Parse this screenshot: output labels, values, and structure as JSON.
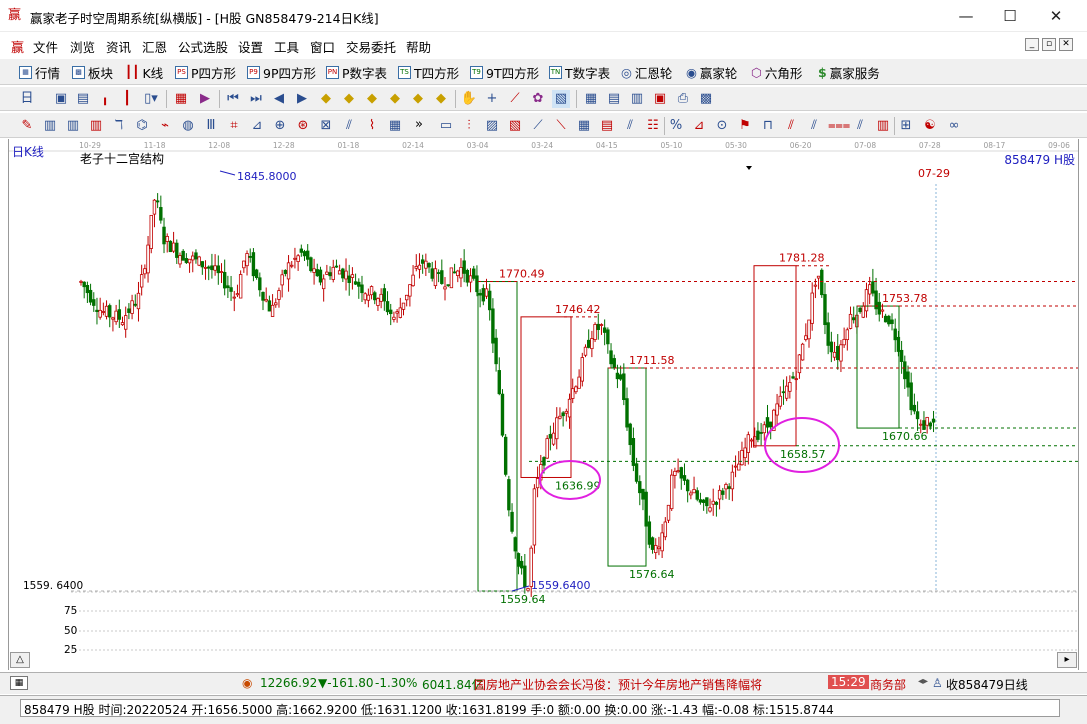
{
  "window": {
    "title": "赢家老子时空周期系统[纵横版] - [H股  GN858479-214日K线]",
    "controls": [
      "—",
      "☐",
      "✕"
    ]
  },
  "menu": {
    "items": [
      "文件",
      "浏览",
      "资讯",
      "汇恩",
      "公式选股",
      "设置",
      "工具",
      "窗口",
      "交易委托",
      "帮助"
    ],
    "mdi_buttons": [
      "_",
      "▫",
      "✕"
    ]
  },
  "toolbar1": [
    {
      "label": "行情",
      "icon": "quote-grid-icon"
    },
    {
      "label": "板块",
      "icon": "sector-icon"
    },
    {
      "label": "K线",
      "icon": "kline-icon"
    },
    {
      "label": "P四方形",
      "icon": "ps-icon",
      "badge": "PS"
    },
    {
      "label": "9P四方形",
      "icon": "p9-icon",
      "badge": "P9"
    },
    {
      "label": "P数字表",
      "icon": "pn-icon",
      "badge": "PN"
    },
    {
      "label": "T四方形",
      "icon": "ts-icon",
      "badge": "TS"
    },
    {
      "label": "9T四方形",
      "icon": "t9-icon",
      "badge": "T9"
    },
    {
      "label": "T数字表",
      "icon": "tn-icon",
      "badge": "TN"
    },
    {
      "label": "汇恩轮",
      "icon": "wheel-icon"
    },
    {
      "label": "赢家轮",
      "icon": "winner-wheel-icon"
    },
    {
      "label": "六角形",
      "icon": "hexagon-icon"
    },
    {
      "label": "赢家服务",
      "icon": "dollar-icon"
    }
  ],
  "toolbar3": {
    "overflow": "»"
  },
  "chart": {
    "period_label": "日K线",
    "indicator_name": "老子十二宫结构",
    "code_label": "858479 H股",
    "cursor_date": "07-29",
    "y_min_label": "1559. 6400",
    "volume_ticks": [
      "75",
      "50",
      "25"
    ],
    "up_color": "#c00000",
    "down_color": "#007000"
  },
  "chart_data": {
    "type": "candlestick",
    "x_dates": [
      "10-29",
      "11-18",
      "12-08",
      "12-28",
      "01-18",
      "02-14",
      "03-04",
      "03-24",
      "04-15",
      "05-10",
      "05-30",
      "06-20",
      "07-08",
      "07-28",
      "08-17",
      "09-06"
    ],
    "annotations": {
      "high_marker": "1845.8000",
      "low_marker": "1559.6400",
      "levels_red": [
        "1770.49",
        "1746.42",
        "1711.58",
        "1781.28",
        "1753.78"
      ],
      "levels_green": [
        "1559.64",
        "1636.99",
        "1576.64",
        "1658.57",
        "1670.66"
      ]
    },
    "price_range": [
      1559.64,
      1845.8
    ]
  },
  "ticker": {
    "index": "12266.92",
    "change": "▼-161.80",
    "pct": "-1.30%",
    "amount": "6041.84亿",
    "news": "国房地产业协会会长冯俊：预计今年房地产销售降幅将",
    "time": "15:29",
    "source": "商务部",
    "receive": "收858479日线"
  },
  "info": {
    "text": "858479 H股 时间:20220524 开:1656.5000 高:1662.9200 低:1631.1200 收:1631.8199 手:0 额:0.00 换:0.00 涨:-1.43 幅:-0.08 标:1515.8744"
  }
}
